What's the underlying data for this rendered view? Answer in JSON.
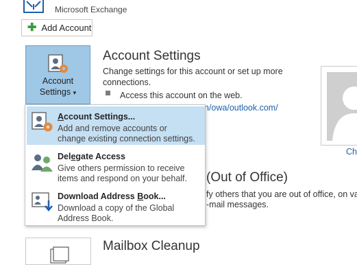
{
  "account": {
    "type_label": "Microsoft Exchange"
  },
  "toolbar": {
    "add_account_label": "Add Account"
  },
  "account_settings": {
    "tile_label_line1": "Account",
    "tile_label_line2": "Settings",
    "tile_arrow": "▾",
    "title": "Account Settings",
    "desc_line1": "Change settings for this account or set up more",
    "desc_line2": "connections.",
    "bullet_text": "Access this account on the web.",
    "owa_link": "n/owa/outlook.com/"
  },
  "profile": {
    "change_label": "Cha"
  },
  "automatic_replies": {
    "title": "(Out of Office)",
    "desc_line1": "fy others that you are out of office, on vac",
    "desc_line2": "-mail messages."
  },
  "mailbox_cleanup": {
    "title": "Mailbox Cleanup"
  },
  "menu": {
    "items": [
      {
        "title_pre": "",
        "title_key": "A",
        "title_post": "ccount Settings...",
        "desc_line1": "Add and remove accounts or",
        "desc_line2": "change existing connection settings."
      },
      {
        "title_pre": "Del",
        "title_key": "e",
        "title_post": "gate Access",
        "desc_line1": "Give others permission to receive",
        "desc_line2": "items and respond on your behalf."
      },
      {
        "title_pre": "Download Address ",
        "title_key": "B",
        "title_post": "ook...",
        "desc_line1": "Download a copy of the Global",
        "desc_line2": "Address Book."
      }
    ]
  },
  "colors": {
    "accent": "#9fc7e6",
    "selected_item": "#c5dff3",
    "link": "#1f5fa8",
    "gear": "#e8883a"
  }
}
